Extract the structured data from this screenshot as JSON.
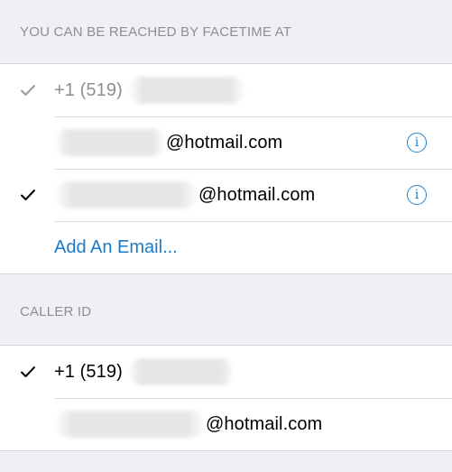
{
  "facetime": {
    "header": "YOU CAN BE REACHED BY FACETIME AT",
    "rows": [
      {
        "prefix": "+1 (519)",
        "suffix": "",
        "checked": true,
        "dim": true,
        "info": false
      },
      {
        "prefix": "",
        "suffix": "@hotmail.com",
        "checked": false,
        "dim": false,
        "info": true
      },
      {
        "prefix": "",
        "suffix": "@hotmail.com",
        "checked": true,
        "dim": false,
        "info": true
      }
    ],
    "add_email": "Add An Email..."
  },
  "caller_id": {
    "header": "CALLER ID",
    "rows": [
      {
        "prefix": "+1 (519)",
        "suffix": "",
        "checked": true
      },
      {
        "prefix": "",
        "suffix": "@hotmail.com",
        "checked": false
      }
    ]
  },
  "colors": {
    "background": "#efeff4",
    "accent": "#1a7ac9",
    "header_text": "#8e8e93"
  },
  "icons": {
    "check": "checkmark-icon",
    "info": "info-icon"
  }
}
